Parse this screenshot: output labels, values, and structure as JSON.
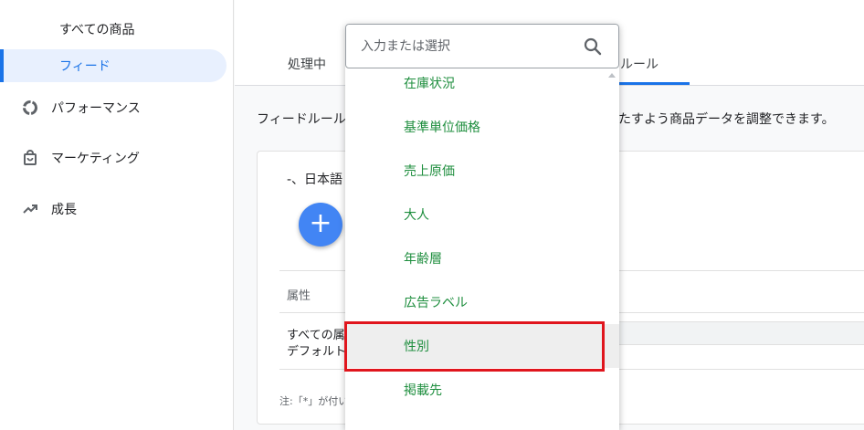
{
  "sidebar": {
    "sub_items": [
      {
        "label": "すべての商品",
        "active": false
      },
      {
        "label": "フィード",
        "active": true
      }
    ],
    "items": [
      {
        "label": "パフォーマンス",
        "icon": "performance-donut-icon"
      },
      {
        "label": "マーケティング",
        "icon": "shopping-bag-icon"
      },
      {
        "label": "成長",
        "icon": "trending-up-icon"
      }
    ]
  },
  "tabs": [
    {
      "label": "処理中"
    },
    {
      "label": "ルール",
      "active": true
    }
  ],
  "content": {
    "description_left": "フィードルール",
    "description_right": "たすよう商品データを調整できます。",
    "language_label": "-、日本語",
    "column_header": "属性",
    "row_line1": "すべての属",
    "row_line2": "デフォルト",
    "note": "注:「*」が付い"
  },
  "dropdown": {
    "placeholder": "入力または選択",
    "options": [
      {
        "label": "在庫状況"
      },
      {
        "label": "基準単位価格"
      },
      {
        "label": "売上原価"
      },
      {
        "label": "大人"
      },
      {
        "label": "年齢層"
      },
      {
        "label": "広告ラベル"
      },
      {
        "label": "性別",
        "highlighted": true
      },
      {
        "label": "掲載先"
      }
    ]
  },
  "colors": {
    "accent": "#1a73e8",
    "fab": "#4285f4",
    "option_text": "#1e8e3e",
    "highlight_box": "#e0151d"
  }
}
